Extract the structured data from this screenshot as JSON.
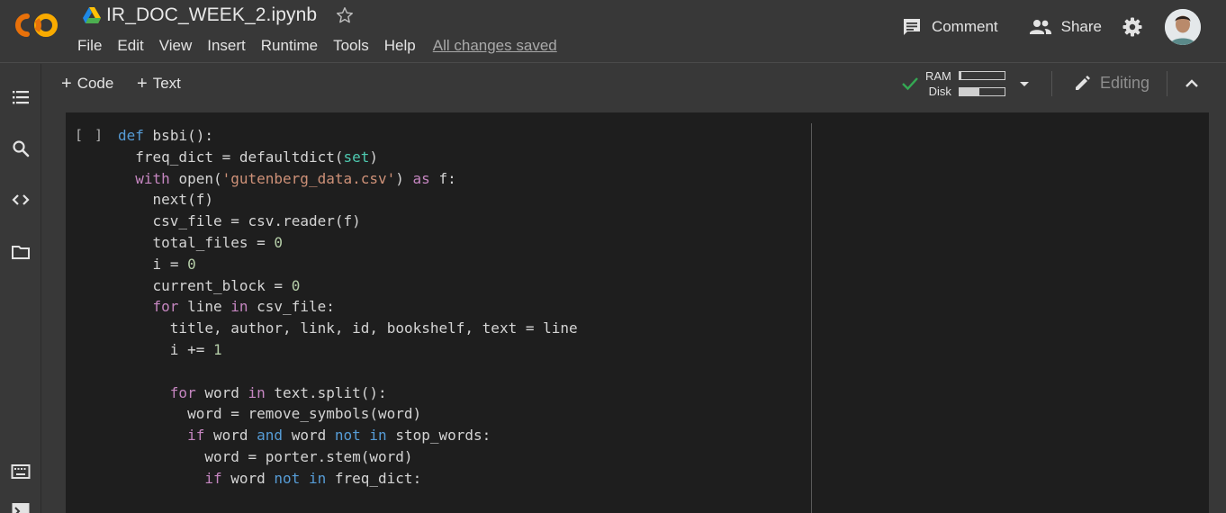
{
  "header": {
    "doc_title": "IR_DOC_WEEK_2.ipynb",
    "menu": [
      "File",
      "Edit",
      "View",
      "Insert",
      "Runtime",
      "Tools",
      "Help"
    ],
    "save_status": "All changes saved",
    "comment_label": "Comment",
    "share_label": "Share"
  },
  "toolbar": {
    "add_code_label": "Code",
    "add_text_label": "Text",
    "ram_label": "RAM",
    "disk_label": "Disk",
    "ram_usage": 0.05,
    "disk_usage": 0.45,
    "editing_label": "Editing"
  },
  "cell": {
    "run_indicator": "[ ]",
    "code_lines": [
      "def bsbi():",
      "  freq_dict = defaultdict(set)",
      "  with open('gutenberg_data.csv') as f:",
      "    next(f)",
      "    csv_file = csv.reader(f)",
      "    total_files = 0",
      "    i = 0",
      "    current_block = 0",
      "    for line in csv_file:",
      "      title, author, link, id, bookshelf, text = line",
      "      i += 1",
      "",
      "      for word in text.split():",
      "        word = remove_symbols(word)",
      "        if word and word not in stop_words:",
      "          word = porter.stem(word)",
      "          if word not in freq_dict:"
    ]
  },
  "colors": {
    "background": "#383838",
    "cell_background": "#1e1e1e",
    "logo_orange": "#f9ab00",
    "logo_dark_orange": "#e8710a",
    "check_green": "#34a853"
  }
}
